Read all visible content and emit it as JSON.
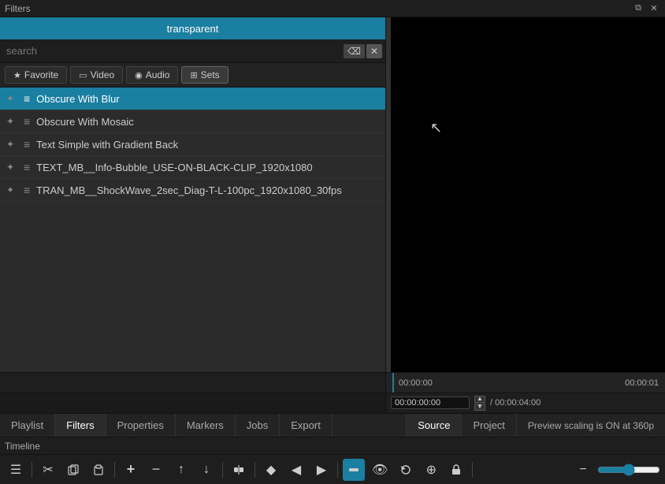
{
  "window": {
    "title": "Filters"
  },
  "transparent_bar": {
    "label": "transparent"
  },
  "search": {
    "placeholder": "search",
    "value": ""
  },
  "tabs": [
    {
      "id": "favorite",
      "label": "Favorite",
      "icon": "★",
      "active": false
    },
    {
      "id": "video",
      "label": "Video",
      "icon": "▭",
      "active": false
    },
    {
      "id": "audio",
      "label": "Audio",
      "icon": "◉",
      "active": false
    },
    {
      "id": "sets",
      "label": "Sets",
      "icon": "⊞",
      "active": true
    }
  ],
  "filters": [
    {
      "id": 1,
      "name": "Obscure With Blur",
      "selected": true
    },
    {
      "id": 2,
      "name": "Obscure With Mosaic",
      "selected": false
    },
    {
      "id": 3,
      "name": "Text Simple with Gradient Back",
      "selected": false
    },
    {
      "id": 4,
      "name": "TEXT_MB__Info-Bubble_USE-ON-BLACK-CLIP_1920x1080",
      "selected": false
    },
    {
      "id": 5,
      "name": "TRAN_MB__ShockWave_2sec_Diag-T-L-100pc_1920x1080_30fps",
      "selected": false
    }
  ],
  "timecodes": {
    "start": "00:00:00",
    "end": "00:00:01",
    "current": "00:00:00:00",
    "total": "/ 00:00:04:00"
  },
  "bottom_tabs": [
    {
      "id": "playlist",
      "label": "Playlist",
      "active": false
    },
    {
      "id": "filters",
      "label": "Filters",
      "active": true
    },
    {
      "id": "properties",
      "label": "Properties",
      "active": false
    },
    {
      "id": "markers",
      "label": "Markers",
      "active": false
    },
    {
      "id": "jobs",
      "label": "Jobs",
      "active": false
    },
    {
      "id": "export",
      "label": "Export",
      "active": false
    }
  ],
  "right_tabs": [
    {
      "id": "source",
      "label": "Source",
      "active": true
    },
    {
      "id": "project",
      "label": "Project",
      "active": false
    }
  ],
  "preview_scaling": "Preview scaling is ON at 360p",
  "timeline": {
    "label": "Timeline"
  },
  "toolbar": {
    "buttons": [
      {
        "id": "menu",
        "icon": "☰",
        "tooltip": "Menu"
      },
      {
        "id": "cut",
        "icon": "✂",
        "tooltip": "Cut"
      },
      {
        "id": "copy",
        "icon": "⧉",
        "tooltip": "Copy"
      },
      {
        "id": "paste",
        "icon": "📋",
        "tooltip": "Paste"
      },
      {
        "id": "add",
        "icon": "+",
        "tooltip": "Add"
      },
      {
        "id": "remove",
        "icon": "−",
        "tooltip": "Remove"
      },
      {
        "id": "up",
        "icon": "↑",
        "tooltip": "Up"
      },
      {
        "id": "down",
        "icon": "↓",
        "tooltip": "Down"
      },
      {
        "id": "split",
        "icon": "⚡",
        "tooltip": "Split"
      },
      {
        "id": "snap",
        "icon": "◆",
        "tooltip": "Snap"
      },
      {
        "id": "prev",
        "icon": "◀",
        "tooltip": "Previous"
      },
      {
        "id": "next",
        "icon": "▶",
        "tooltip": "Next"
      },
      {
        "id": "ripple",
        "icon": "⬛",
        "tooltip": "Ripple",
        "active": true
      },
      {
        "id": "scrub",
        "icon": "👁",
        "tooltip": "Scrub"
      },
      {
        "id": "loop",
        "icon": "⟳",
        "tooltip": "Loop"
      },
      {
        "id": "multi",
        "icon": "⊕",
        "tooltip": "Multi"
      },
      {
        "id": "lock",
        "icon": "🔒",
        "tooltip": "Lock"
      },
      {
        "id": "zoom-out",
        "icon": "−",
        "tooltip": "Zoom Out"
      }
    ]
  }
}
